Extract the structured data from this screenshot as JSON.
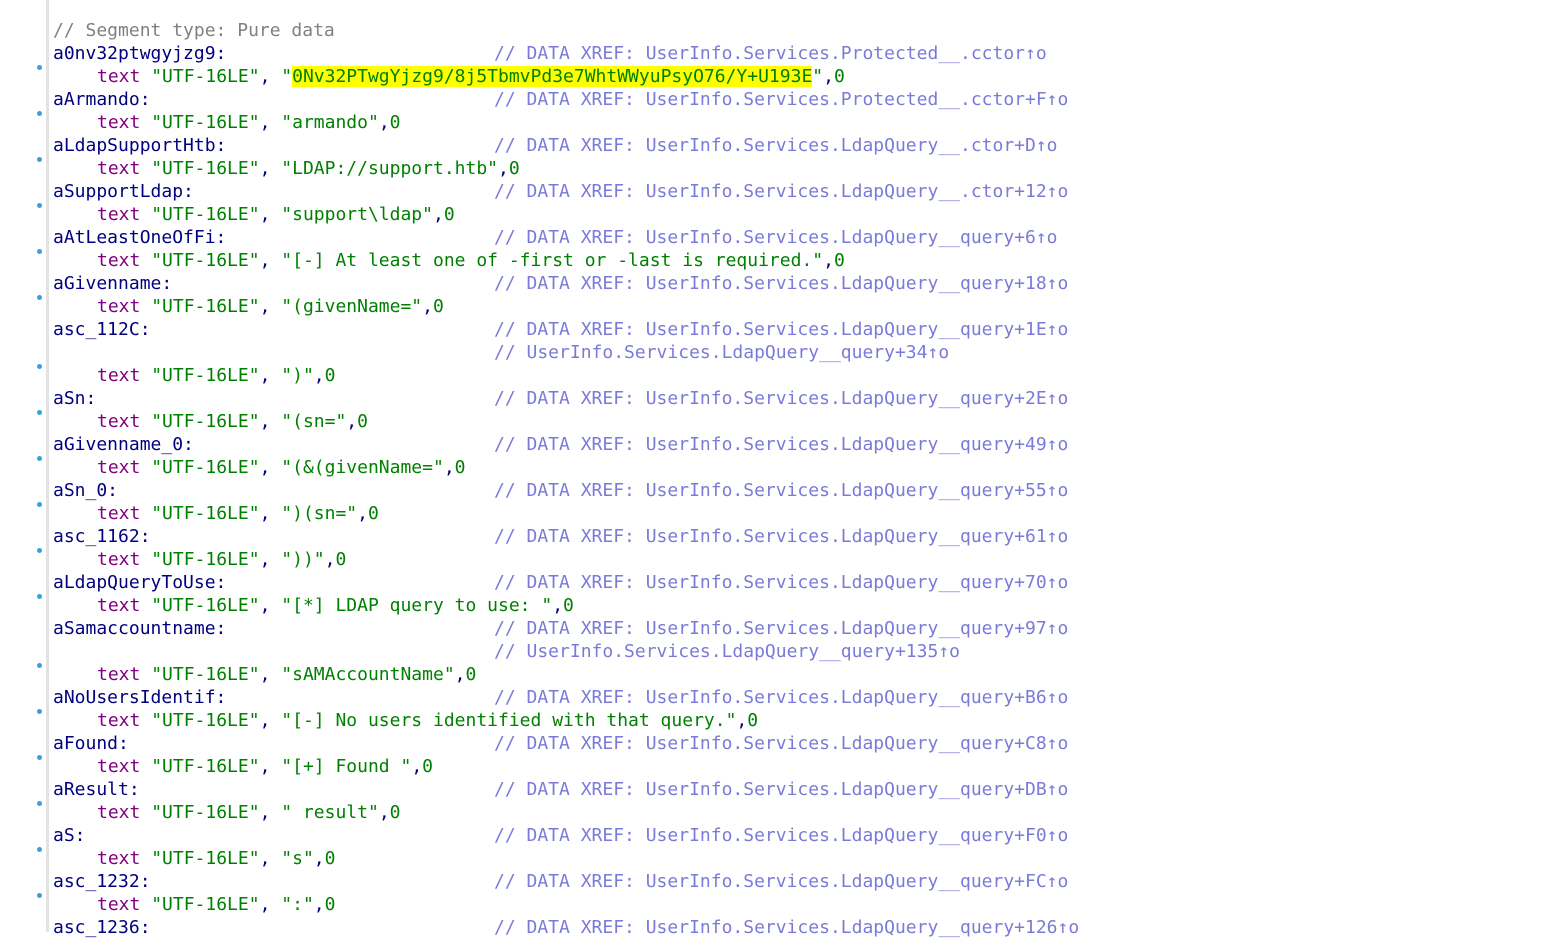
{
  "segment_comment": "// Segment type: Pure data",
  "directive": "text",
  "encoding": "\"UTF-16LE\"",
  "terminator": "0",
  "highlight_color": "#ffff00",
  "entries": [
    {
      "label": "a0nv32ptwgyjzg9:",
      "xrefs": [
        "// DATA XREF: UserInfo.Services.Protected__.cctor↑o"
      ],
      "value": "\"0Nv32PTwgYjzg9/8j5TbmvPd3e7WhtWWyuPsyO76/Y+U193E\"",
      "highlighted": true
    },
    {
      "label": "aArmando:",
      "xrefs": [
        "// DATA XREF: UserInfo.Services.Protected__.cctor+F↑o"
      ],
      "value": "\"armando\""
    },
    {
      "label": "aLdapSupportHtb:",
      "xrefs": [
        "// DATA XREF: UserInfo.Services.LdapQuery__.ctor+D↑o"
      ],
      "value": "\"LDAP://support.htb\""
    },
    {
      "label": "aSupportLdap:",
      "xrefs": [
        "// DATA XREF: UserInfo.Services.LdapQuery__.ctor+12↑o"
      ],
      "value": "\"support\\ldap\""
    },
    {
      "label": "aAtLeastOneOfFi:",
      "xrefs": [
        "// DATA XREF: UserInfo.Services.LdapQuery__query+6↑o"
      ],
      "value": "\"[-] At least one of -first or -last is required.\""
    },
    {
      "label": "aGivenname:",
      "xrefs": [
        "// DATA XREF: UserInfo.Services.LdapQuery__query+18↑o"
      ],
      "value": "\"(givenName=\""
    },
    {
      "label": "asc_112C:",
      "xrefs": [
        "// DATA XREF: UserInfo.Services.LdapQuery__query+1E↑o",
        "// UserInfo.Services.LdapQuery__query+34↑o"
      ],
      "value": "\")\""
    },
    {
      "label": "aSn:",
      "xrefs": [
        "// DATA XREF: UserInfo.Services.LdapQuery__query+2E↑o"
      ],
      "value": "\"(sn=\""
    },
    {
      "label": "aGivenname_0:",
      "xrefs": [
        "// DATA XREF: UserInfo.Services.LdapQuery__query+49↑o"
      ],
      "value": "\"(&(givenName=\""
    },
    {
      "label": "aSn_0:",
      "xrefs": [
        "// DATA XREF: UserInfo.Services.LdapQuery__query+55↑o"
      ],
      "value": "\")(sn=\""
    },
    {
      "label": "asc_1162:",
      "xrefs": [
        "// DATA XREF: UserInfo.Services.LdapQuery__query+61↑o"
      ],
      "value": "\"))\""
    },
    {
      "label": "aLdapQueryToUse:",
      "xrefs": [
        "// DATA XREF: UserInfo.Services.LdapQuery__query+70↑o"
      ],
      "value": "\"[*] LDAP query to use: \""
    },
    {
      "label": "aSamaccountname:",
      "xrefs": [
        "// DATA XREF: UserInfo.Services.LdapQuery__query+97↑o",
        "// UserInfo.Services.LdapQuery__query+135↑o"
      ],
      "value": "\"sAMAccountName\""
    },
    {
      "label": "aNoUsersIdentif:",
      "xrefs": [
        "// DATA XREF: UserInfo.Services.LdapQuery__query+B6↑o"
      ],
      "value": "\"[-] No users identified with that query.\""
    },
    {
      "label": "aFound:",
      "xrefs": [
        "// DATA XREF: UserInfo.Services.LdapQuery__query+C8↑o"
      ],
      "value": "\"[+] Found \""
    },
    {
      "label": "aResult:",
      "xrefs": [
        "// DATA XREF: UserInfo.Services.LdapQuery__query+DB↑o"
      ],
      "value": "\" result\""
    },
    {
      "label": "aS:",
      "xrefs": [
        "// DATA XREF: UserInfo.Services.LdapQuery__query+F0↑o"
      ],
      "value": "\"s\""
    },
    {
      "label": "asc_1232:",
      "xrefs": [
        "// DATA XREF: UserInfo.Services.LdapQuery__query+FC↑o"
      ],
      "value": "\":\""
    },
    {
      "label": "asc_1236:",
      "xrefs": [
        "// DATA XREF: UserInfo.Services.LdapQuery__query+126↑o"
      ],
      "value": ""
    }
  ]
}
